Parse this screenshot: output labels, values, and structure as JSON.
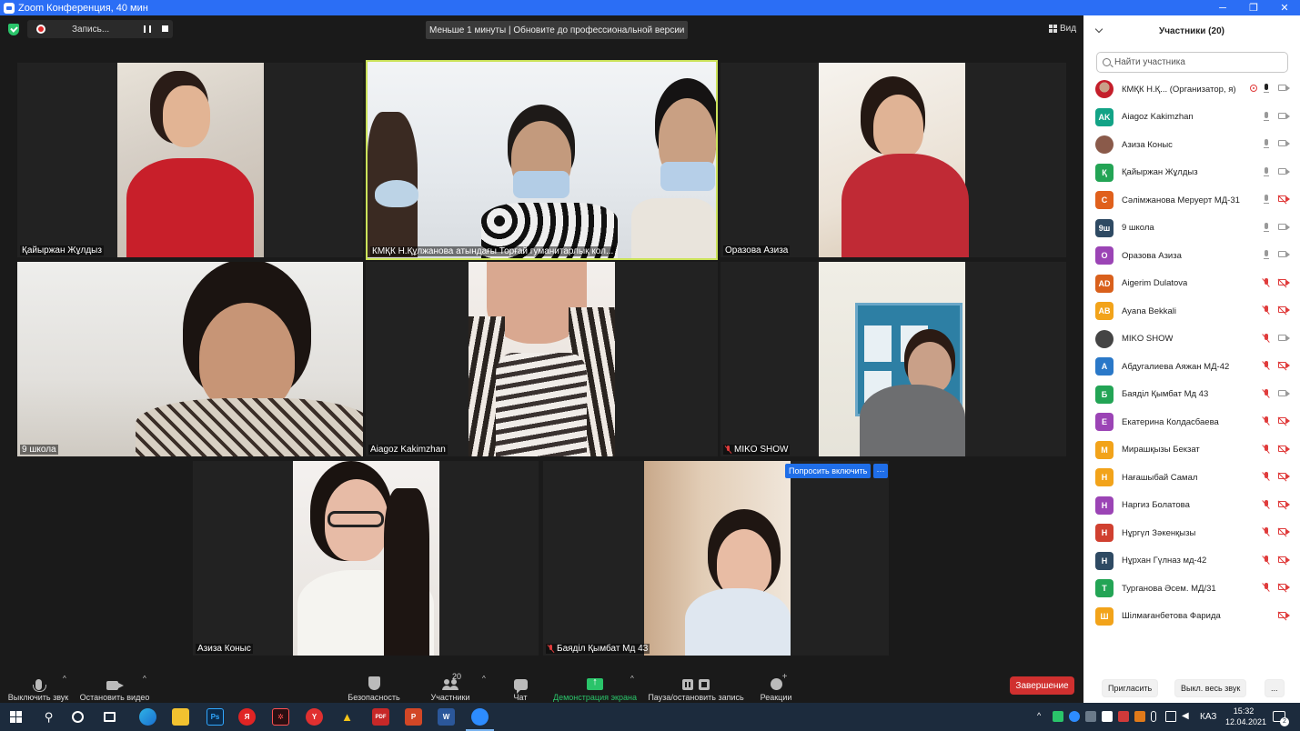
{
  "window": {
    "title": "Zoom Конференция, 40 мин"
  },
  "topbar": {
    "recording_label": "Запись...",
    "upgrade_banner": "Меньше 1 минуты | Обновите до профессиональной версии",
    "view_label": "Вид"
  },
  "tiles": [
    {
      "name": "Қайыржан Жұлдыз"
    },
    {
      "name": "КМҚК Н.Құлжанова атындағы Торғай гуманитарлық кол..."
    },
    {
      "name": "Оразова Азиза"
    },
    {
      "name": "9 школа"
    },
    {
      "name": "Aiagoz Kakimzhan"
    },
    {
      "name": "MIKO SHOW"
    },
    {
      "name": "Азиза Коныс"
    },
    {
      "name": "Баяділ Қымбат Мд 43"
    }
  ],
  "ask_to_unmute": "Попросить включить",
  "more_label": "···",
  "controls": {
    "mute": "Выключить звук",
    "stop_video": "Остановить видео",
    "security": "Безопасность",
    "participants": "Участники",
    "participants_count": "20",
    "chat": "Чат",
    "share": "Демонстрация экрана",
    "pause_record": "Пауза/остановить запись",
    "reactions": "Реакции",
    "end": "Завершение"
  },
  "panel": {
    "title": "Участники (20)",
    "search_placeholder": "Найти участника",
    "participants": [
      {
        "name": "КМҚК Н.Қ... (Организатор, я)",
        "avatar": "",
        "color": "#f0f0f0",
        "mic": "active",
        "cam": "on"
      },
      {
        "name": "Aiagoz Kakimzhan",
        "avatar": "AK",
        "color": "#12a386",
        "mic": "on",
        "cam": "on"
      },
      {
        "name": "Азиза Коныс",
        "avatar": "",
        "color": "#8a5a4a",
        "mic": "on",
        "cam": "on"
      },
      {
        "name": "Қайыржан Жұлдыз",
        "avatar": "Қ",
        "color": "#23a455",
        "mic": "on",
        "cam": "on"
      },
      {
        "name": "Сәлімжанова Меруерт МД-31",
        "avatar": "С",
        "color": "#e0601c",
        "mic": "on",
        "cam": "off"
      },
      {
        "name": "9 школа",
        "avatar": "9ш",
        "color": "#2e4a63",
        "mic": "on",
        "cam": "on"
      },
      {
        "name": "Оразова Азиза",
        "avatar": "О",
        "color": "#9b44b5",
        "mic": "on",
        "cam": "on"
      },
      {
        "name": "Aigerim Dulatova",
        "avatar": "AD",
        "color": "#d9601c",
        "mic": "muted",
        "cam": "off"
      },
      {
        "name": "Ayana Bekkali",
        "avatar": "AB",
        "color": "#f2a31a",
        "mic": "muted",
        "cam": "off"
      },
      {
        "name": "MIKO SHOW",
        "avatar": "",
        "color": "#444444",
        "mic": "muted",
        "cam": "on"
      },
      {
        "name": "Абдугалиева Аяжан МД-42",
        "avatar": "А",
        "color": "#2a78c8",
        "mic": "muted",
        "cam": "off"
      },
      {
        "name": "Баяділ Қымбат Мд 43",
        "avatar": "Б",
        "color": "#23a455",
        "mic": "muted",
        "cam": "on"
      },
      {
        "name": "Екатерина Колдасбаева",
        "avatar": "Е",
        "color": "#9b44b5",
        "mic": "muted",
        "cam": "off"
      },
      {
        "name": "Мирашқызы Бекзат",
        "avatar": "М",
        "color": "#f2a31a",
        "mic": "muted",
        "cam": "off"
      },
      {
        "name": "Нағашыбай Самал",
        "avatar": "Н",
        "color": "#f2a31a",
        "mic": "muted",
        "cam": "off"
      },
      {
        "name": "Наргиз Болатова",
        "avatar": "Н",
        "color": "#9b44b5",
        "mic": "muted",
        "cam": "off"
      },
      {
        "name": "Нұргүл Зәкенқызы",
        "avatar": "Н",
        "color": "#d04030",
        "mic": "muted",
        "cam": "off"
      },
      {
        "name": "Нұрхан Гүлназ мд-42",
        "avatar": "Н",
        "color": "#2e4a63",
        "mic": "muted",
        "cam": "off"
      },
      {
        "name": "Турганова Әсем. МД/31",
        "avatar": "Т",
        "color": "#23a455",
        "mic": "muted",
        "cam": "off"
      },
      {
        "name": "Шілмағанбетова Фарида",
        "avatar": "Ш",
        "color": "#f2a31a",
        "mic": "none",
        "cam": "off"
      }
    ],
    "invite": "Пригласить",
    "mute_all": "Выкл. весь звук",
    "more": "..."
  },
  "taskbar": {
    "lang": "КАЗ",
    "time": "15:32",
    "date": "12.04.2021",
    "notifications": "2"
  }
}
